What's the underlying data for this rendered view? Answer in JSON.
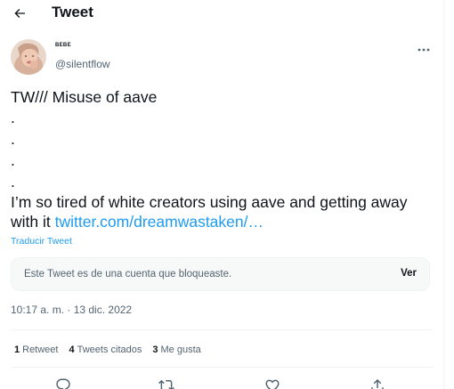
{
  "header": {
    "title": "Tweet"
  },
  "author": {
    "display_name": "BEBE",
    "handle": "@silentflow"
  },
  "tweet": {
    "lines": [
      "TW/// Misuse of aave",
      ".",
      ".",
      ".",
      "."
    ],
    "body_prefix": "I’m so tired of white creators using aave and getting away with it ",
    "link_text": "twitter.com/dreamwastaken/…",
    "translate_label": "Traducir Tweet"
  },
  "notice": {
    "text": "Este Tweet es de una cuenta que bloqueaste.",
    "button_label": "Ver"
  },
  "timestamp": "10:17 a. m. · 13 dic. 2022",
  "stats": {
    "retweets": {
      "count": "1",
      "label": "Retweet"
    },
    "quotes": {
      "count": "4",
      "label": "Tweets citados"
    },
    "likes": {
      "count": "3",
      "label": "Me gusta"
    }
  },
  "icons": {
    "back": "arrow-left-icon",
    "more": "more-horizontal-icon",
    "reply": "reply-icon",
    "retweet": "retweet-icon",
    "like": "heart-icon",
    "share": "share-icon"
  },
  "colors": {
    "accent": "#1d9bf0",
    "text": "#0f1419",
    "secondary": "#536471",
    "border": "#eff3f4",
    "notice_bg": "#f7f9f9"
  }
}
